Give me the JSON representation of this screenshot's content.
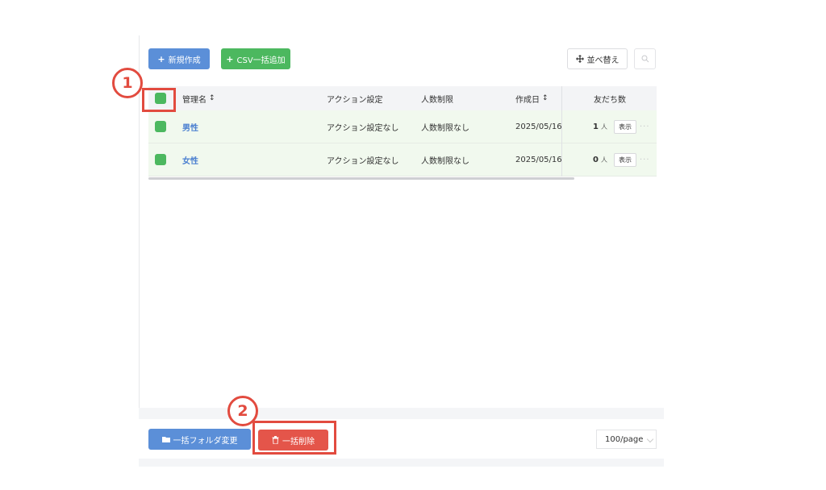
{
  "toolbar": {
    "new_label": "新規作成",
    "csv_label": "CSV一括追加",
    "sort_label": "並べ替え"
  },
  "table": {
    "headers": {
      "name": "管理名",
      "action": "アクション設定",
      "limit": "人数制限",
      "created": "作成日",
      "friends": "友だち数"
    },
    "rows": [
      {
        "name": "男性",
        "action": "アクション設定なし",
        "limit": "人数制限なし",
        "created": "2025/05/16",
        "friends": "1",
        "friends_unit": "人",
        "show_label": "表示",
        "more": "···"
      },
      {
        "name": "女性",
        "action": "アクション設定なし",
        "limit": "人数制限なし",
        "created": "2025/05/16",
        "friends": "0",
        "friends_unit": "人",
        "show_label": "表示",
        "more": "···"
      }
    ]
  },
  "footer": {
    "folder_label": "一括フォルダ変更",
    "delete_label": "一括削除",
    "page_size": "100/page"
  },
  "annotations": {
    "step1": "1",
    "step2": "2"
  },
  "colors": {
    "primary_blue": "#5b8fd8",
    "green": "#4cb85f",
    "danger_red": "#e4554a",
    "annotation_red": "#e24b3f"
  }
}
